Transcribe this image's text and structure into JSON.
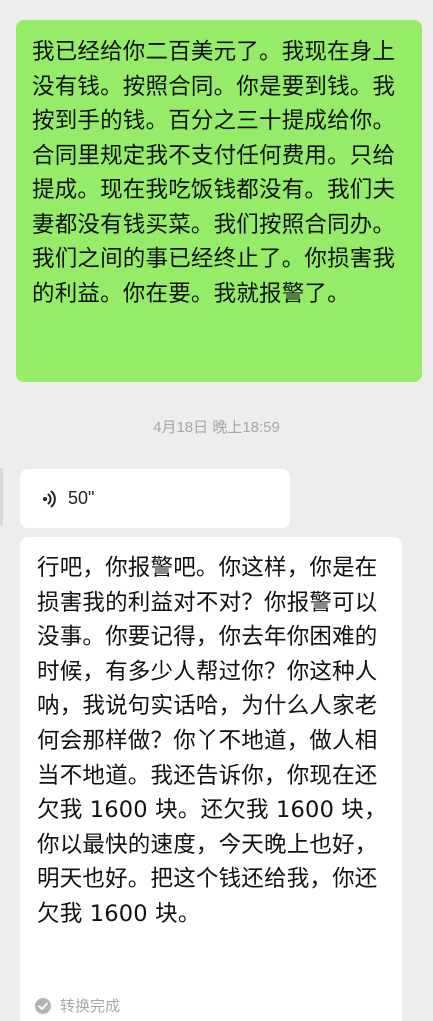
{
  "messages": {
    "outgoing_text": "我已经给你二百美元了。我现在身上没有钱。按照合同。你是要到钱。我按到手的钱。百分之三十提成给你。合同里规定我不支付任何费用。只给提成。现在我吃饭钱都没有。我们夫妻都没有钱买菜。我们按照合同办。我们之间的事已经终止了。你损害我的利益。你在要。我就报警了。",
    "timestamp": "4月18日 晚上18:59",
    "voice": {
      "duration": "50\"",
      "icon": "voice-wave-icon"
    },
    "transcript_text": "行吧，你报警吧。你这样，你是在损害我的利益对不对？你报警可以没事。你要记得，你去年你困难的时候，有多少人帮过你？你这种人呐，我说句实话哈，为什么人家老何会那样做？你丫不地道，做人相当不地道。我还告诉你，你现在还欠我 1600 块。还欠我 1600 块，你以最快的速度，今天晚上也好，明天也好。把这个钱还给我，你还欠我 1600 块。",
    "transcript_status": "转换完成",
    "status_icon": "check-circle-icon"
  },
  "colors": {
    "outgoing_bubble": "#95ec69",
    "incoming_bubble": "#ffffff",
    "background": "#ededed",
    "meta_text": "#a6a6a6"
  }
}
